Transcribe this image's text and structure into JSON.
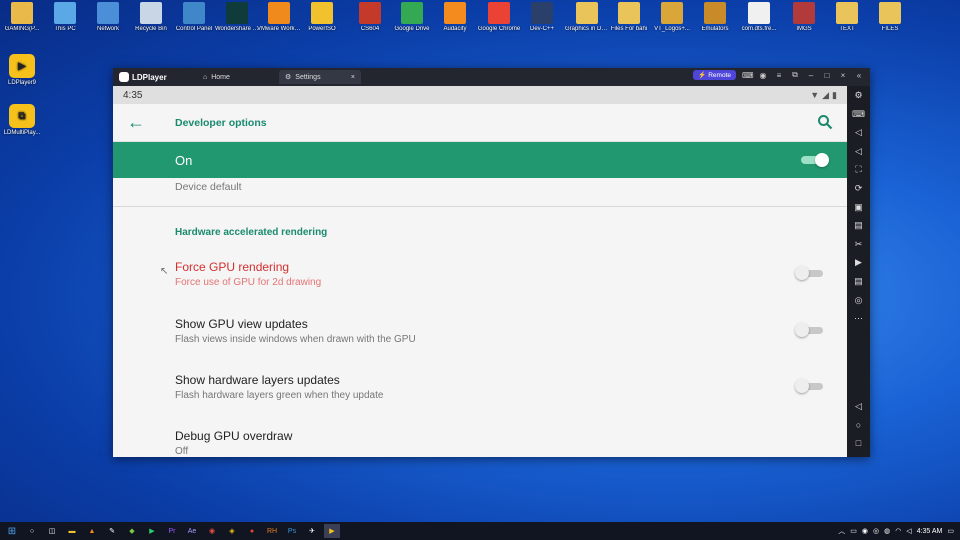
{
  "desktop": {
    "icons": [
      {
        "label": "GAMING(P...",
        "name": "gaming-folder-icon",
        "color": "#e9b949"
      },
      {
        "label": "This PC",
        "name": "this-pc-icon",
        "color": "#5aa9e6"
      },
      {
        "label": "Network",
        "name": "network-icon",
        "color": "#4a8fd8"
      },
      {
        "label": "Recycle Bin",
        "name": "recycle-bin-icon",
        "color": "#c9d6e6"
      },
      {
        "label": "Control Panel",
        "name": "control-panel-icon",
        "color": "#3f87c9"
      },
      {
        "label": "Wondershare Filmora 12",
        "name": "filmora-icon",
        "color": "#0f3b3a"
      },
      {
        "label": "VMware Workstati...",
        "name": "vmware-icon",
        "color": "#f08a1c"
      },
      {
        "label": "PowerISO",
        "name": "poweriso-icon",
        "color": "#f2c12e"
      },
      {
        "label": "CS604",
        "name": "cs604-icon",
        "color": "#c43a2a"
      },
      {
        "label": "Google Drive",
        "name": "google-drive-icon",
        "color": "#34a853"
      },
      {
        "label": "Audacity",
        "name": "audacity-icon",
        "color": "#f48b1e"
      },
      {
        "label": "Google Chrome",
        "name": "chrome-icon",
        "color": "#ea4335"
      },
      {
        "label": "Dev-C++",
        "name": "devcpp-icon",
        "color": "#2a3f6a"
      },
      {
        "label": "Graphics in Dev C++",
        "name": "graphics-folder-icon",
        "color": "#e9c45a"
      },
      {
        "label": "Files For bahi",
        "name": "files-for-bahi-icon",
        "color": "#e9c45a"
      },
      {
        "label": "VT_Logos+...",
        "name": "vt-logos-icon",
        "color": "#d9a63a"
      },
      {
        "label": "Emulators",
        "name": "emulators-icon",
        "color": "#c98a2a"
      },
      {
        "label": "com.dts.fre...",
        "name": "dts-file-icon",
        "color": "#f0f0f0"
      },
      {
        "label": "IMGS",
        "name": "imgs-folder-icon",
        "color": "#b23a3a"
      },
      {
        "label": "TEXT",
        "name": "text-folder-icon",
        "color": "#e9c45a"
      },
      {
        "label": "FILES",
        "name": "files-folder-icon",
        "color": "#e9c45a"
      }
    ],
    "side_icons": [
      {
        "label": "LDPlayer9",
        "name": "ldplayer9-icon"
      },
      {
        "label": "LDMultiPlay...",
        "name": "ldmultiplayer-icon"
      }
    ]
  },
  "emulator": {
    "app_name": "LDPlayer",
    "tabs": [
      {
        "label": "Home"
      },
      {
        "label": "Settings"
      }
    ],
    "remote_label": "Remote",
    "android": {
      "time": "4:35",
      "title": "Developer options",
      "master_switch_label": "On",
      "device_default": "Device default",
      "section_header": "Hardware accelerated rendering",
      "prefs": [
        {
          "title": "Force GPU rendering",
          "summary": "Force use of GPU for 2d drawing"
        },
        {
          "title": "Show GPU view updates",
          "summary": "Flash views inside windows when drawn with the GPU"
        },
        {
          "title": "Show hardware layers updates",
          "summary": "Flash hardware layers green when they update"
        },
        {
          "title": "Debug GPU overdraw",
          "summary": "Off"
        }
      ]
    }
  },
  "taskbar": {
    "time": "4:35 AM"
  }
}
